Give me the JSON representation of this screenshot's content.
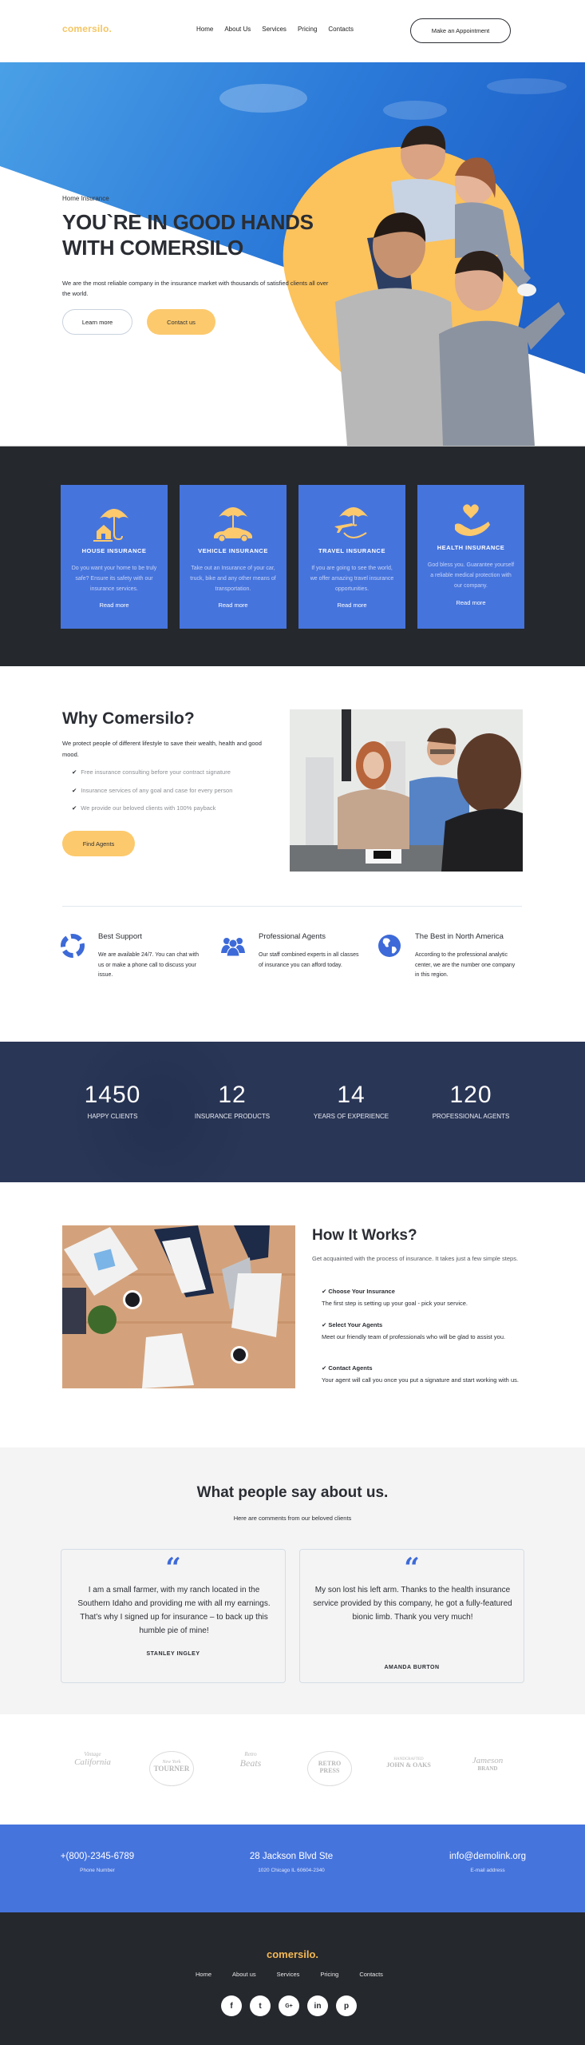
{
  "header": {
    "logo": "comersilo.",
    "nav": [
      "Home",
      "About Us",
      "Services",
      "Pricing",
      "Contacts"
    ],
    "cta": "Make an Appointment"
  },
  "hero": {
    "kicker": "Home Insurance",
    "title": "YOU`RE IN GOOD HANDS WITH COMERSILO",
    "description": "We are the most reliable company in the insurance market with thousands of satisfied clients all over the world.",
    "learn_more": "Learn more",
    "contact_us": "Contact us"
  },
  "services": [
    {
      "icon": "umbrella-house-icon",
      "title": "HOUSE INSURANCE",
      "text": "Do you want your home to be truly safe? Ensure its safety with our insurance services.",
      "link": "Read more"
    },
    {
      "icon": "umbrella-car-icon",
      "title": "VEHICLE INSURANCE",
      "text": "Take out an Insurance of your car, truck, bike and any other means of transportation.",
      "link": "Read more"
    },
    {
      "icon": "umbrella-plane-icon",
      "title": "TRAVEL INSURANCE",
      "text": "If you are going to see the world, we offer amazing travel insurance opportunities.",
      "link": "Read more"
    },
    {
      "icon": "heart-hand-icon",
      "title": "HEALTH INSURANCE",
      "text": "God bless you. Guarantee yourself a reliable medical protection with our company.",
      "link": "Read more"
    }
  ],
  "why": {
    "title": "Why Comersilo?",
    "description": "We protect people of different lifestyle to save their wealth, health and good mood.",
    "points": [
      "Free insurance consulting before your contract signature",
      "Insurance services of any goal and case for every person",
      "We provide our beloved clients with 100% payback"
    ],
    "button": "Find Agents"
  },
  "features": [
    {
      "icon": "lifebuoy-icon",
      "title": "Best Support",
      "text": "We are available 24/7. You can chat with us or make a phone call to discuss your issue."
    },
    {
      "icon": "users-icon",
      "title": "Professional Agents",
      "text": "Our staff combined experts in all classes of insurance you can afford today."
    },
    {
      "icon": "globe-icon",
      "title": "The Best in North America",
      "text": "According to the professional analytic center, we are the number one company in this region."
    }
  ],
  "stats": [
    {
      "value": "1450",
      "label": "HAPPY CLIENTS"
    },
    {
      "value": "12",
      "label": "INSURANCE PRODUCTS"
    },
    {
      "value": "14",
      "label": "YEARS OF EXPERIENCE"
    },
    {
      "value": "120",
      "label": "PROFESSIONAL AGENTS"
    }
  ],
  "how": {
    "title": "How It Works?",
    "description": "Get acquainted with the process of insurance. It takes just a few simple steps.",
    "steps": [
      {
        "title": "Choose Your Insurance",
        "text": "The first step is setting up your goal - pick your service."
      },
      {
        "title": "Select Your Agents",
        "text": "Meet our friendly team of professionals who will be glad to assist you."
      },
      {
        "title": "Contact Agents",
        "text": "Your agent will call you once you put a signature and start working with us."
      }
    ]
  },
  "testimonials": {
    "title": "What people say about us.",
    "subtitle": "Here are comments from our beloved clients",
    "items": [
      {
        "text": "I am a small farmer, with my ranch located in the Southern Idaho and providing me with all my earnings. That’s why I signed up for insurance – to back up this humble pie of mine!",
        "name": "STANLEY INGLEY"
      },
      {
        "text": "My son lost his left arm. Thanks to the health insurance service provided by this company, he got a fully-featured bionic limb. Thank you very much!",
        "name": "AMANDA BURTON"
      }
    ]
  },
  "brands": [
    {
      "top": "Vintage",
      "main": "California"
    },
    {
      "top": "New York",
      "main": "TOURNER"
    },
    {
      "top": "Retro",
      "main": "Beats"
    },
    {
      "top": "RETRO",
      "main": "PRESS"
    },
    {
      "top": "HANDCRAFTED",
      "main": "JOHN & OAKS"
    },
    {
      "top": "Jameson",
      "main": "BRAND"
    }
  ],
  "contacts": [
    {
      "main": "+(800)-2345-6789",
      "sub": "Phone Number"
    },
    {
      "main": "28 Jackson Blvd Ste",
      "sub": "1020 Chicago IL 60604-2340"
    },
    {
      "main": "info@demolink.org",
      "sub": "E-mail address"
    }
  ],
  "footer": {
    "logo": "comersilo.",
    "nav": [
      "Home",
      "About us",
      "Services",
      "Pricing",
      "Contacts"
    ],
    "socials": [
      {
        "icon": "facebook-icon",
        "glyph": "f"
      },
      {
        "icon": "twitter-icon",
        "glyph": "t"
      },
      {
        "icon": "google-plus-icon",
        "glyph": "G+"
      },
      {
        "icon": "linkedin-icon",
        "glyph": "in"
      },
      {
        "icon": "pinterest-icon",
        "glyph": "p"
      }
    ]
  }
}
